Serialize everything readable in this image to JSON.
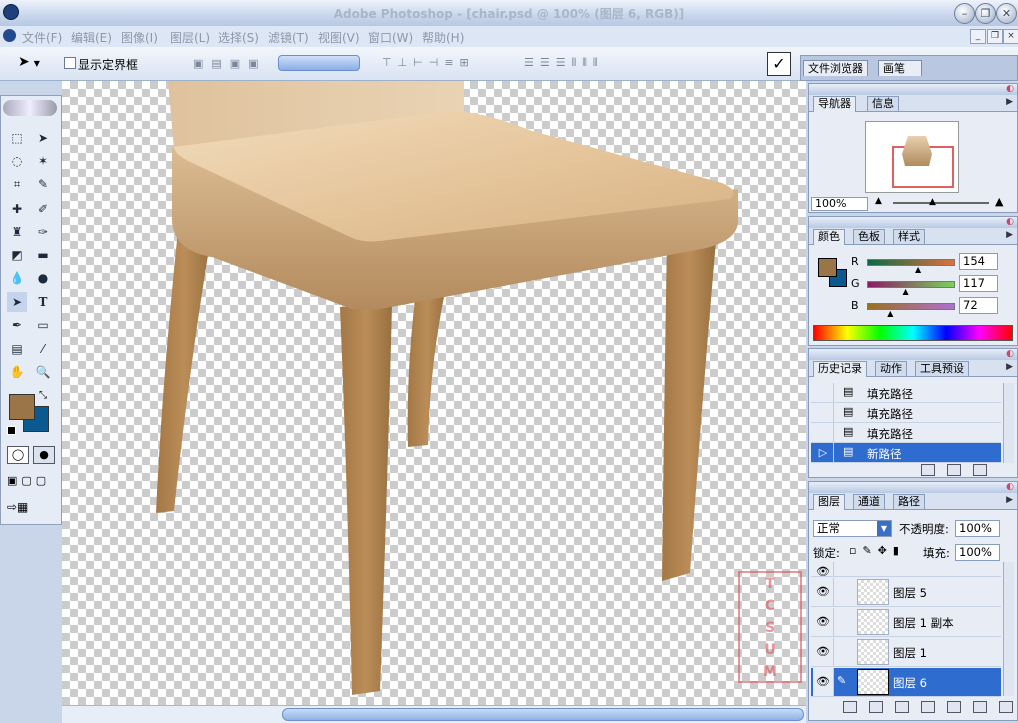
{
  "window": {
    "title": "Adobe Photoshop - [chair.psd @ 100% (图层 6, RGB)]"
  },
  "menu": [
    "文件(F)",
    "编辑(E)",
    "图像(I)",
    "图层(L)",
    "选择(S)",
    "滤镜(T)",
    "视图(V)",
    "窗口(W)",
    "帮助(H)"
  ],
  "options": {
    "show_bounds_label": "显示定界框",
    "commit": "✓"
  },
  "palette_well": {
    "tabs": [
      "文件浏览器",
      "画笔"
    ]
  },
  "navigator": {
    "tabs": [
      "导航器",
      "信息"
    ],
    "zoom": "100%"
  },
  "color": {
    "tabs": [
      "颜色",
      "色板",
      "样式"
    ],
    "r_label": "R",
    "g_label": "G",
    "b_label": "B",
    "r": "154",
    "g": "117",
    "b": "72",
    "fg": "#9a7548",
    "bg": "#0a5a8f",
    "r_pos": 0.604,
    "g_pos": 0.459,
    "b_pos": 0.282
  },
  "history": {
    "tabs": [
      "历史记录",
      "动作",
      "工具预设"
    ],
    "items": [
      {
        "label": "填充路径"
      },
      {
        "label": "填充路径"
      },
      {
        "label": "填充路径"
      },
      {
        "label": "新路径"
      }
    ]
  },
  "layers": {
    "tabs": [
      "图层",
      "通道",
      "路径"
    ],
    "blend_mode": "正常",
    "opacity_label": "不透明度:",
    "opacity": "100%",
    "lock_label": "锁定:",
    "fill_label": "填充:",
    "fill": "100%",
    "items": [
      {
        "name": "图层 5"
      },
      {
        "name": "图层 1 副本"
      },
      {
        "name": "图层 1"
      },
      {
        "name": "图层 6"
      }
    ]
  },
  "tools": {
    "fg": "#9a7548",
    "bg": "#0a5a8f"
  }
}
